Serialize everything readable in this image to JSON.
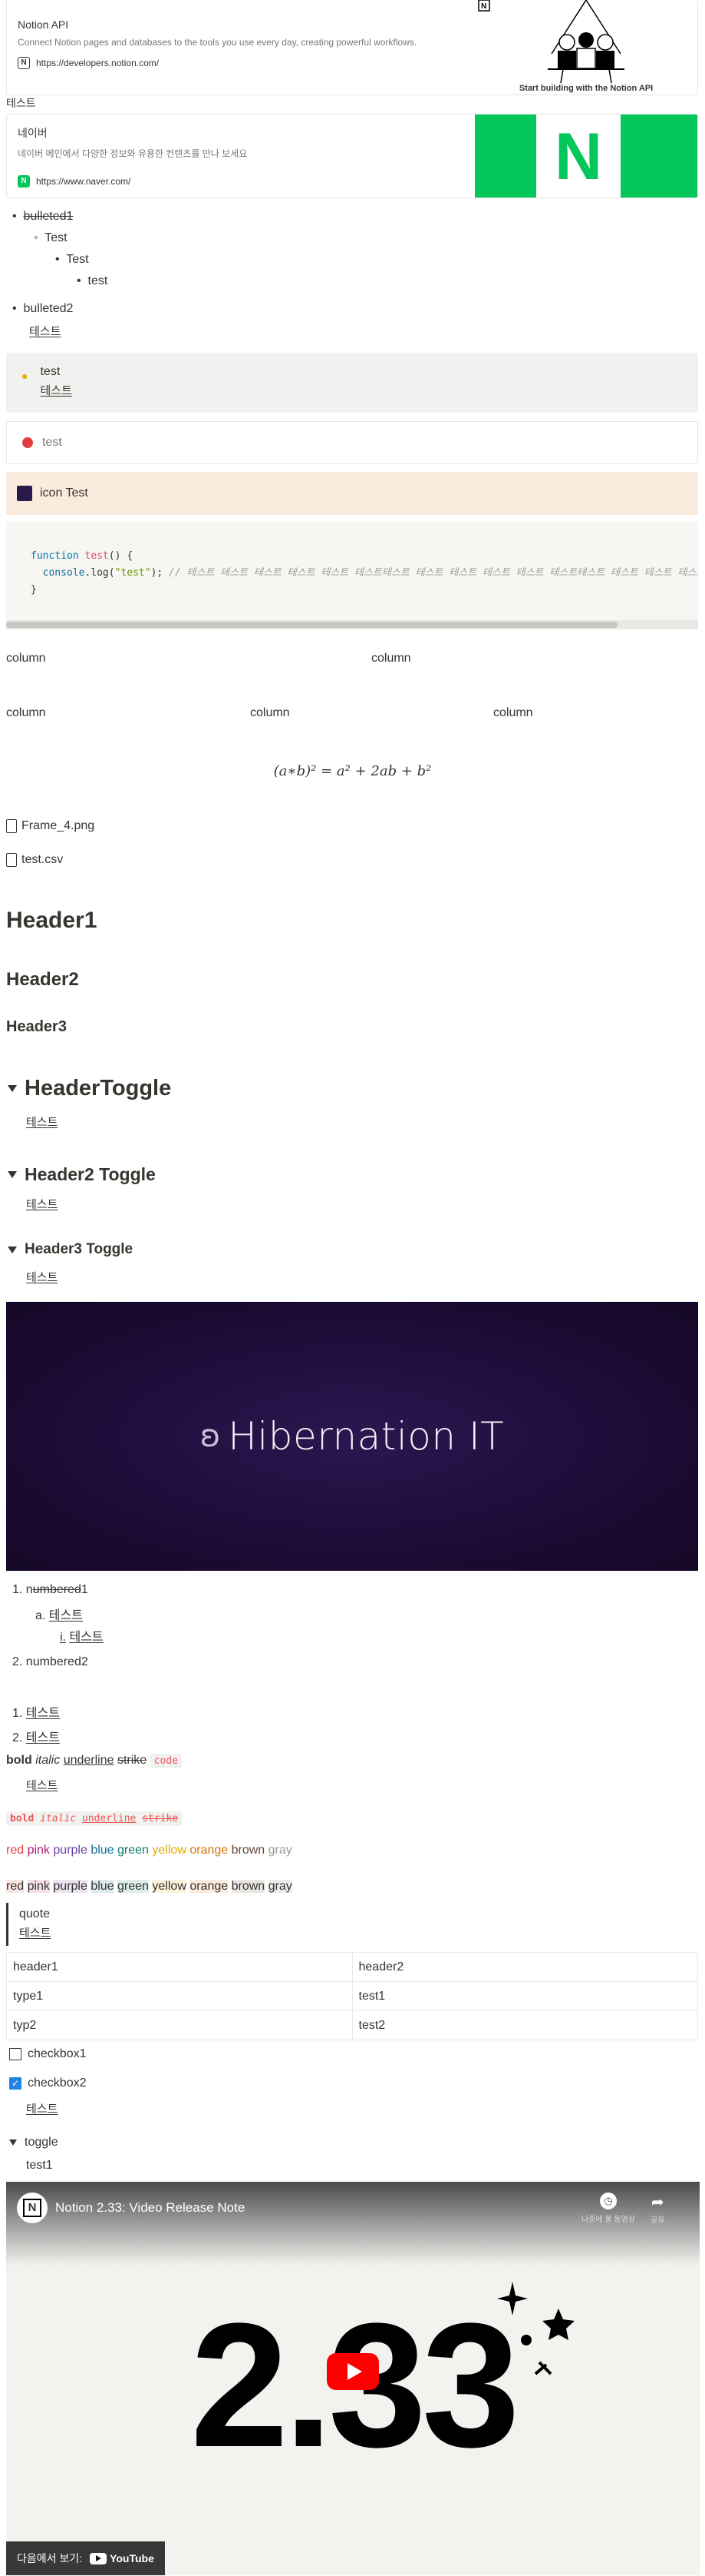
{
  "bookmarks": [
    {
      "title": "Notion API",
      "desc": "Connect Notion pages and databases to the tools you use every day, creating powerful workflows.",
      "url": "https://developers.notion.com/",
      "favicon": "notion-icon",
      "image_caption": "Start building with the Notion API"
    },
    {
      "title": "네이버",
      "desc": "네이버 메인에서 다양한 정보와 유용한 컨텐츠를 만나 보세요",
      "url": "https://www.naver.com/",
      "favicon": "naver-icon",
      "logo_letter": "N"
    }
  ],
  "caption1": "테스트",
  "bullets": {
    "b1": "bulleted1",
    "b1_a": "Test",
    "b1_b": "Test",
    "b1_c": "test",
    "b2": "bulleted2",
    "b2_child": "테스트"
  },
  "callouts": {
    "c1_title": "test",
    "c1_child": "테스트",
    "c2": "test",
    "c3": "icon Test"
  },
  "code": {
    "line1_kw": "function",
    "line1_name": "test",
    "line1_rest": "() {",
    "line2_obj": "console",
    "line2_dot": ".log(",
    "line2_str": "\"test\"",
    "line2_end": ");",
    "line2_comment": "// 테스트 테스트 테스트 테스트 테스트 테스트테스트 테스트 테스트 테스트 테스트 테스트테스트 테스트 테스트 테스트 테스트테스트",
    "line3": "}"
  },
  "columns2": [
    "column",
    "column"
  ],
  "columns3": [
    "column",
    "column",
    "column"
  ],
  "equation": "(a∗b)² = a² + 2ab + b²",
  "files": [
    "Frame_4.png",
    "test.csv"
  ],
  "headers": {
    "h1": "Header1",
    "h2": "Header2",
    "h3": "Header3"
  },
  "toggle_headers": [
    {
      "title": "HeaderToggle",
      "child": "테스트"
    },
    {
      "title": "Header2 Toggle",
      "child": "테스트"
    },
    {
      "title": "Header3 Toggle",
      "child": "테스트"
    }
  ],
  "banner": {
    "text": "Hibernation IT"
  },
  "numbered": {
    "n1_pre": "1. ",
    "n1_u": "n",
    "n1_s": "umbered",
    "n1_post": "1",
    "n1_a_marker": "a.",
    "n1_a": "테스트",
    "n1_i_marker": "i.",
    "n1_i": "테스트",
    "n2_marker": "2.",
    "n2": "numbered2",
    "m1_marker": "1.",
    "m1": "테스트",
    "m2_marker": "2.",
    "m2": "테스트"
  },
  "format": {
    "bold": "bold",
    "italic": "italic",
    "underline": "underline",
    "strike": "strike",
    "code": "code",
    "child": "테스트"
  },
  "colors_text": [
    {
      "t": "red",
      "c": "#e03e3e"
    },
    {
      "t": "pink",
      "c": "#ad1a72"
    },
    {
      "t": "purple",
      "c": "#6940a5"
    },
    {
      "t": "blue",
      "c": "#0b6e99"
    },
    {
      "t": "green",
      "c": "#0f7b6c"
    },
    {
      "t": "yellow",
      "c": "#dfab01"
    },
    {
      "t": "orange",
      "c": "#d9730d"
    },
    {
      "t": "brown",
      "c": "#64473a"
    },
    {
      "t": "gray",
      "c": "#9b9a97"
    }
  ],
  "colors_bg": [
    {
      "t": "red",
      "bg": "#fbe4e4"
    },
    {
      "t": "pink",
      "bg": "#f4dfeb"
    },
    {
      "t": "purple",
      "bg": "#eae4f2"
    },
    {
      "t": "blue",
      "bg": "#ddebf1"
    },
    {
      "t": "green",
      "bg": "#ddedea"
    },
    {
      "t": "yellow",
      "bg": "#fbf3db"
    },
    {
      "t": "orange",
      "bg": "#faebdd"
    },
    {
      "t": "brown",
      "bg": "#e9e5e3"
    },
    {
      "t": "gray",
      "bg": "#ebeced"
    }
  ],
  "quote": {
    "text": "quote",
    "child": "테스트"
  },
  "table": {
    "rows": [
      [
        "header1",
        "header2"
      ],
      [
        "type1",
        "test1"
      ],
      [
        "typ2",
        "test2"
      ]
    ]
  },
  "checkboxes": [
    {
      "label": "checkbox1",
      "checked": false
    },
    {
      "label": "checkbox2",
      "checked": true,
      "child": "테스트"
    }
  ],
  "toggle": {
    "title": "toggle",
    "child": "test1"
  },
  "video": {
    "title": "Notion 2.33: Video Release Note",
    "big": "2.33",
    "watch_label": "다음에서 보기:",
    "yt_label": "YouTube",
    "watch_later": "나중에 볼 동영상",
    "share": "공유"
  }
}
